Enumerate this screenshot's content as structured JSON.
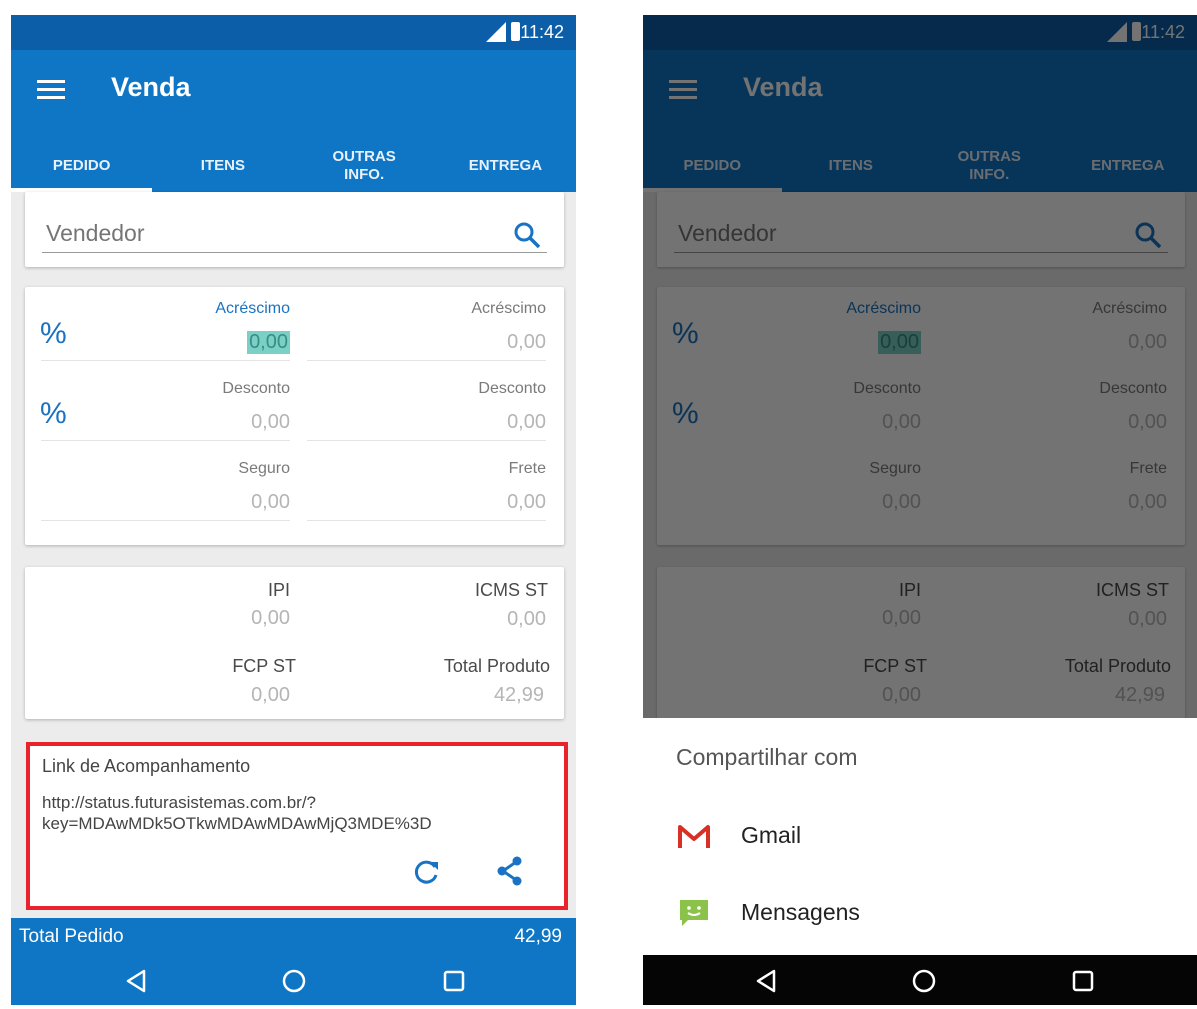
{
  "status": {
    "time": "11:42"
  },
  "app": {
    "title": "Venda",
    "tabs": [
      {
        "label": "PEDIDO"
      },
      {
        "label": "ITENS"
      },
      {
        "label": "OUTRAS INFO."
      },
      {
        "label": "ENTREGA"
      }
    ]
  },
  "vendedor": {
    "placeholder": "Vendedor"
  },
  "adjustments": {
    "percent_symbol": "%",
    "acrescimo_pct_label": "Acréscimo",
    "acrescimo_pct_value": "0,00",
    "acrescimo_label": "Acréscimo",
    "acrescimo_value": "0,00",
    "desconto_pct_label": "Desconto",
    "desconto_pct_value": "0,00",
    "desconto_label": "Desconto",
    "desconto_value": "0,00",
    "seguro_label": "Seguro",
    "seguro_value": "0,00",
    "frete_label": "Frete",
    "frete_value": "0,00"
  },
  "taxes": {
    "ipi_label": "IPI",
    "ipi_value": "0,00",
    "icms_label": "ICMS ST",
    "icms_value": "0,00",
    "fcp_label": "FCP ST",
    "fcp_value": "0,00",
    "total_produto_label": "Total Produto",
    "total_produto_value": "42,99"
  },
  "link": {
    "title": "Link de Acompanhamento",
    "url_line1": "http://status.futurasistemas.com.br/?",
    "url_line2": "key=MDAwMDk5OTkwMDAwMDAwMjQ3MDE%3D"
  },
  "footer": {
    "total_label": "Total Pedido",
    "total_value": "42,99"
  },
  "share_sheet": {
    "title": "Compartilhar com",
    "options": [
      {
        "name": "Gmail",
        "icon": "gmail-icon"
      },
      {
        "name": "Mensagens",
        "icon": "messages-icon"
      }
    ]
  },
  "colors": {
    "primary": "#0f76c6",
    "accent": "#1a73c2",
    "highlight": "#e8232b"
  }
}
